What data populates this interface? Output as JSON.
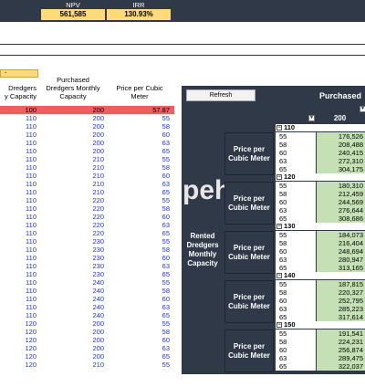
{
  "kpis": {
    "npv_label": "NPV",
    "npv_value": "561,585",
    "irr_label": "IRR",
    "irr_value": "130.93%"
  },
  "input_box": {
    "text": "-"
  },
  "headers": {
    "rented": "Dredgers\ny Capacity",
    "purchased": "Purchased\nDredgers Monthly\nCapacity",
    "price": "Price per Cubic\nMeter"
  },
  "table_rows": [
    [
      "100",
      "200",
      "57.87"
    ],
    [
      "110",
      "200",
      "55"
    ],
    [
      "110",
      "200",
      "58"
    ],
    [
      "110",
      "200",
      "60"
    ],
    [
      "110",
      "200",
      "63"
    ],
    [
      "110",
      "200",
      "65"
    ],
    [
      "110",
      "210",
      "55"
    ],
    [
      "110",
      "210",
      "58"
    ],
    [
      "110",
      "210",
      "60"
    ],
    [
      "110",
      "210",
      "63"
    ],
    [
      "110",
      "210",
      "65"
    ],
    [
      "110",
      "220",
      "55"
    ],
    [
      "110",
      "220",
      "58"
    ],
    [
      "110",
      "220",
      "60"
    ],
    [
      "110",
      "220",
      "63"
    ],
    [
      "110",
      "220",
      "65"
    ],
    [
      "110",
      "230",
      "55"
    ],
    [
      "110",
      "230",
      "58"
    ],
    [
      "110",
      "230",
      "60"
    ],
    [
      "110",
      "230",
      "63"
    ],
    [
      "110",
      "230",
      "65"
    ],
    [
      "110",
      "240",
      "55"
    ],
    [
      "110",
      "240",
      "58"
    ],
    [
      "110",
      "240",
      "60"
    ],
    [
      "110",
      "240",
      "63"
    ],
    [
      "110",
      "240",
      "65"
    ],
    [
      "120",
      "200",
      "55"
    ],
    [
      "120",
      "200",
      "58"
    ],
    [
      "120",
      "200",
      "60"
    ],
    [
      "120",
      "200",
      "63"
    ],
    [
      "120",
      "200",
      "65"
    ],
    [
      "120",
      "210",
      "55"
    ]
  ],
  "pivot": {
    "refresh_label": "Refresh",
    "title": "Purchased",
    "column_value": "200",
    "rented_label": "Rented\nDredgers\nMonthly\nCapacity",
    "price_label": "Price per\nCubic Meter",
    "watermark": "peh",
    "groups": [
      {
        "name": "110",
        "rows": [
          [
            "55",
            "176,526"
          ],
          [
            "58",
            "208,488"
          ],
          [
            "60",
            "240,415"
          ],
          [
            "63",
            "272,310"
          ],
          [
            "65",
            "304,175"
          ]
        ]
      },
      {
        "name": "120",
        "rows": [
          [
            "55",
            "180,310"
          ],
          [
            "58",
            "212,459"
          ],
          [
            "60",
            "244,569"
          ],
          [
            "63",
            "276,644"
          ],
          [
            "65",
            "308,686"
          ]
        ]
      },
      {
        "name": "130",
        "rows": [
          [
            "55",
            "184,073"
          ],
          [
            "58",
            "216,404"
          ],
          [
            "60",
            "248,694"
          ],
          [
            "63",
            "280,947"
          ],
          [
            "65",
            "313,165"
          ]
        ]
      },
      {
        "name": "140",
        "rows": [
          [
            "55",
            "187,815"
          ],
          [
            "58",
            "220,327"
          ],
          [
            "60",
            "252,795"
          ],
          [
            "63",
            "285,223"
          ],
          [
            "65",
            "317,614"
          ]
        ]
      },
      {
        "name": "150",
        "rows": [
          [
            "55",
            "191,541"
          ],
          [
            "58",
            "224,231"
          ],
          [
            "60",
            "256,874"
          ],
          [
            "63",
            "289,475"
          ],
          [
            "65",
            "322,037"
          ]
        ]
      }
    ]
  }
}
